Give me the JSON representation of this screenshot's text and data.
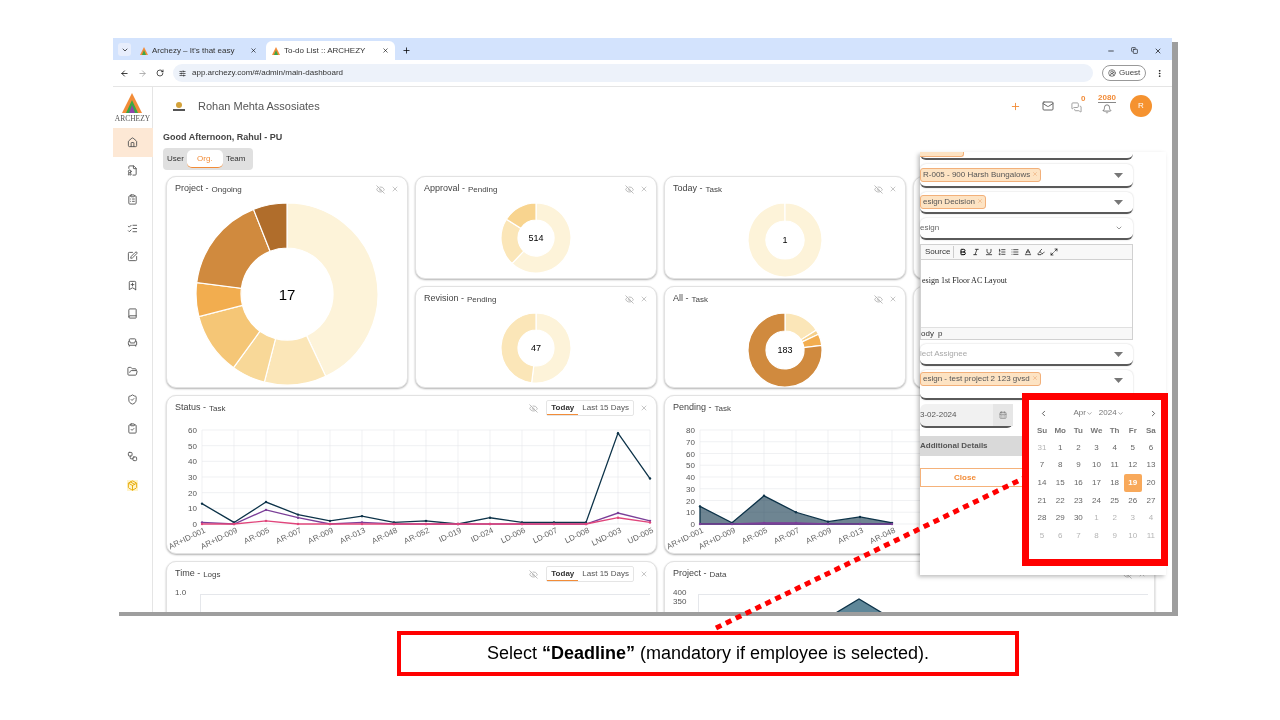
{
  "browser": {
    "tabs": [
      {
        "title": "Archezy – It's that easy",
        "selected": false
      },
      {
        "title": "To-do List :: ARCHEZY",
        "selected": true
      }
    ],
    "url": "app.archezy.com/#/admin/main-dashboard",
    "profile": "Guest"
  },
  "sidebar": {
    "logo_text": "ARCHEZY",
    "items": [
      {
        "selected": true,
        "highlighted": false
      },
      {
        "selected": false,
        "highlighted": false
      },
      {
        "selected": false,
        "highlighted": false
      },
      {
        "selected": false,
        "highlighted": false
      },
      {
        "selected": false,
        "highlighted": false
      },
      {
        "selected": false,
        "highlighted": false
      },
      {
        "selected": false,
        "highlighted": false
      },
      {
        "selected": false,
        "highlighted": false
      },
      {
        "selected": false,
        "highlighted": false
      },
      {
        "selected": false,
        "highlighted": false
      },
      {
        "selected": false,
        "highlighted": false
      },
      {
        "selected": false,
        "highlighted": false
      },
      {
        "selected": false,
        "highlighted": true
      }
    ]
  },
  "header": {
    "company": "Rohan Mehta Assosiates",
    "chat_count": "0",
    "notification_count": "2080",
    "avatar": "R"
  },
  "greeting": "Good Afternoon, Rahul - PU",
  "scope_tabs": [
    {
      "label": "User",
      "selected": false
    },
    {
      "label": "Org.",
      "selected": true
    },
    {
      "label": "Team",
      "selected": false
    }
  ],
  "cards": [
    {
      "kind": "donut",
      "title": "Project -",
      "subtitle": "Ongoing",
      "value": "17"
    },
    {
      "kind": "donut",
      "title": "Approval -",
      "subtitle": "Pending",
      "value": "514"
    },
    {
      "kind": "donut",
      "title": "Today -",
      "subtitle": "Task",
      "value": "1"
    },
    {
      "kind": "donut",
      "title": "Revision -",
      "subtitle": "Pending",
      "value": "47"
    },
    {
      "kind": "donut",
      "title": "All -",
      "subtitle": "Task",
      "value": "183"
    },
    {
      "kind": "chart",
      "title": "Status -",
      "subtitle": "Task",
      "ranges": [
        {
          "label": "Today",
          "selected": true
        },
        {
          "label": "Last 15 Days",
          "selected": false
        }
      ],
      "chart_data": {
        "type": "line",
        "categories": [
          "AR+ID-001",
          "AR+ID-009",
          "AR-005",
          "AR-007",
          "AR-009",
          "AR-013",
          "AR-048",
          "AR-052",
          "ID-019",
          "ID-024",
          "LD-006",
          "LD-007",
          "LD-008",
          "LND-003",
          "UD-005"
        ],
        "series": [
          {
            "color": "#0d3349",
            "values": [
              13,
              1,
              14,
              6,
              2,
              5,
              1,
              2,
              0,
              4,
              1,
              1,
              1,
              58,
              29
            ]
          },
          {
            "color": "#7b3f98",
            "values": [
              1,
              0,
              9,
              4,
              0,
              1,
              0,
              0,
              0,
              0,
              0,
              0,
              0,
              7,
              2
            ]
          },
          {
            "color": "#e0457b",
            "values": [
              0,
              0,
              2,
              0,
              0,
              0,
              0,
              0,
              0,
              0,
              0,
              0,
              0,
              4,
              1
            ]
          }
        ],
        "grid": true,
        "ylim": [
          0,
          60
        ],
        "yticks": [
          0,
          10,
          20,
          30,
          40,
          50,
          60
        ]
      }
    },
    {
      "kind": "chart",
      "title": "Pending -",
      "subtitle": "Task",
      "chart_data": {
        "type": "area",
        "categories": [
          "AR+ID-001",
          "AR+ID-009",
          "AR-005",
          "AR-007",
          "AR-009",
          "AR-013",
          "AR-048"
        ],
        "series": [
          {
            "color": "#0d3349",
            "values": [
              15,
              1,
              24,
              10,
              2,
              6,
              1
            ]
          },
          {
            "color": "#7b3f98",
            "values": [
              0,
              0,
              1,
              1,
              0,
              0,
              0
            ]
          }
        ],
        "grid": true,
        "ylim": [
          0,
          80
        ],
        "yticks": [
          0,
          10,
          20,
          30,
          40,
          50,
          60,
          70,
          80
        ]
      }
    },
    {
      "kind": "partial",
      "title": "Time -",
      "subtitle": "Logs",
      "ranges": [
        {
          "label": "Today",
          "selected": true
        },
        {
          "label": "Last 15 Days",
          "selected": false
        }
      ],
      "axis_labels": [
        "1.0"
      ]
    },
    {
      "kind": "partial",
      "title": "Project -",
      "subtitle": "Data",
      "axis_labels": [
        "400",
        "350"
      ]
    }
  ],
  "task_form": {
    "fields": [
      {
        "kind": "tag_select",
        "tags": [
          "R-005 - 900 Harsh Bungalows"
        ]
      },
      {
        "kind": "tag_select",
        "tags": [
          "esign Decision"
        ]
      },
      {
        "kind": "select",
        "value": "esign"
      },
      {
        "kind": "editor",
        "source_label": "Source",
        "text": "esign 1st Floor AC Layout",
        "path": [
          "ody",
          "p"
        ]
      },
      {
        "kind": "tag_select",
        "placeholder": "lect Assignee"
      },
      {
        "kind": "tag_select",
        "tags": [
          "esign - test project 2 123 gvsd"
        ]
      },
      {
        "kind": "date",
        "value": "3-02-2024"
      },
      {
        "kind": "section",
        "label": "Additional Details"
      },
      {
        "kind": "button",
        "label": "Close"
      }
    ]
  },
  "calendar": {
    "month": "Apr",
    "year": "2024",
    "weekdays": [
      "Su",
      "Mo",
      "Tu",
      "We",
      "Th",
      "Fr",
      "Sa"
    ],
    "days": [
      {
        "label": "31",
        "outside": true,
        "selected": false
      },
      {
        "label": "1",
        "outside": false,
        "selected": false
      },
      {
        "label": "2",
        "outside": false,
        "selected": false
      },
      {
        "label": "3",
        "outside": false,
        "selected": false
      },
      {
        "label": "4",
        "outside": false,
        "selected": false
      },
      {
        "label": "5",
        "outside": false,
        "selected": false
      },
      {
        "label": "6",
        "outside": false,
        "selected": false
      },
      {
        "label": "7",
        "outside": false,
        "selected": false
      },
      {
        "label": "8",
        "outside": false,
        "selected": false
      },
      {
        "label": "9",
        "outside": false,
        "selected": false
      },
      {
        "label": "10",
        "outside": false,
        "selected": false
      },
      {
        "label": "11",
        "outside": false,
        "selected": false
      },
      {
        "label": "12",
        "outside": false,
        "selected": false
      },
      {
        "label": "13",
        "outside": false,
        "selected": false
      },
      {
        "label": "14",
        "outside": false,
        "selected": false
      },
      {
        "label": "15",
        "outside": false,
        "selected": false
      },
      {
        "label": "16",
        "outside": false,
        "selected": false
      },
      {
        "label": "17",
        "outside": false,
        "selected": false
      },
      {
        "label": "18",
        "outside": false,
        "selected": false
      },
      {
        "label": "19",
        "outside": false,
        "selected": true
      },
      {
        "label": "20",
        "outside": false,
        "selected": false
      },
      {
        "label": "21",
        "outside": false,
        "selected": false
      },
      {
        "label": "22",
        "outside": false,
        "selected": false
      },
      {
        "label": "23",
        "outside": false,
        "selected": false
      },
      {
        "label": "24",
        "outside": false,
        "selected": false
      },
      {
        "label": "25",
        "outside": false,
        "selected": false
      },
      {
        "label": "26",
        "outside": false,
        "selected": false
      },
      {
        "label": "27",
        "outside": false,
        "selected": false
      },
      {
        "label": "28",
        "outside": false,
        "selected": false
      },
      {
        "label": "29",
        "outside": false,
        "selected": false
      },
      {
        "label": "30",
        "outside": false,
        "selected": false
      },
      {
        "label": "1",
        "outside": true,
        "selected": false
      },
      {
        "label": "2",
        "outside": true,
        "selected": false
      },
      {
        "label": "3",
        "outside": true,
        "selected": false
      },
      {
        "label": "4",
        "outside": true,
        "selected": false
      },
      {
        "label": "5",
        "outside": true,
        "selected": false
      },
      {
        "label": "6",
        "outside": true,
        "selected": false
      },
      {
        "label": "7",
        "outside": true,
        "selected": false
      },
      {
        "label": "8",
        "outside": true,
        "selected": false
      },
      {
        "label": "9",
        "outside": true,
        "selected": false
      },
      {
        "label": "10",
        "outside": true,
        "selected": false
      },
      {
        "label": "11",
        "outside": true,
        "selected": false
      }
    ]
  },
  "callout": "Select **“Deadline”** (mandatory if employee is selected)."
}
